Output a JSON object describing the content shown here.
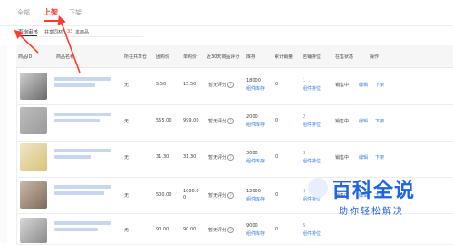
{
  "tabs": {
    "all": "全部",
    "on": "上架",
    "off": "下架"
  },
  "subtabs": {
    "review": "查询审核",
    "shared": "共享同材",
    "count": "33",
    "items": "本商品"
  },
  "columns": [
    "商品ID",
    "商品名称",
    "所在共享仓",
    "团购价",
    "单购价",
    "近30天商品评分",
    "库存",
    "累计销量",
    "店铺排位",
    "在售状态",
    "操作"
  ],
  "rows": [
    {
      "share": "无",
      "group": "5.50",
      "single": "15.50",
      "rating": "暂无评分",
      "stock": "18000",
      "stock_link": "组件库存",
      "sales": "0",
      "rank": "1",
      "rank_link": "组件排位",
      "status": "销售中",
      "edit": "编辑",
      "down": "下架"
    },
    {
      "share": "无",
      "group": "555.00",
      "single": "999.00",
      "rating": "暂无评分",
      "stock": "2000",
      "stock_link": "组件库存",
      "sales": "0",
      "rank": "2",
      "rank_link": "组件排位",
      "status": "销售中",
      "edit": "编辑",
      "down": "下架"
    },
    {
      "share": "无",
      "group": "31.30",
      "single": "31.30",
      "rating": "暂无评分",
      "stock": "3000",
      "stock_link": "组件库存",
      "sales": "0",
      "rank": "3",
      "rank_link": "组件排位",
      "status": "销售中",
      "edit": "编辑",
      "down": "下架"
    },
    {
      "share": "无",
      "group": "500.00",
      "single": "1000.0",
      "single2": "0",
      "rating": "暂无评分",
      "stock": "12000",
      "stock_link": "组件库存",
      "sales": "0",
      "rank": "4",
      "rank_link": "组件排位",
      "status": "销售中",
      "edit": "编辑",
      "down": "下架"
    },
    {
      "share": "无",
      "group": "90.00",
      "single": "90.00",
      "rating": "暂无评分",
      "stock": "9000",
      "stock_link": "组件库存",
      "sales": "0",
      "rank": "5",
      "rank_link": "组件排位",
      "status": "销售中",
      "edit": "编辑",
      "down": "下架"
    }
  ],
  "watermark": {
    "main": "百科全说",
    "sub": "助你轻松解决"
  },
  "colors": {
    "accent": "#ff3b30",
    "link": "#3a7bd5",
    "watermark": "#1f63e6"
  }
}
